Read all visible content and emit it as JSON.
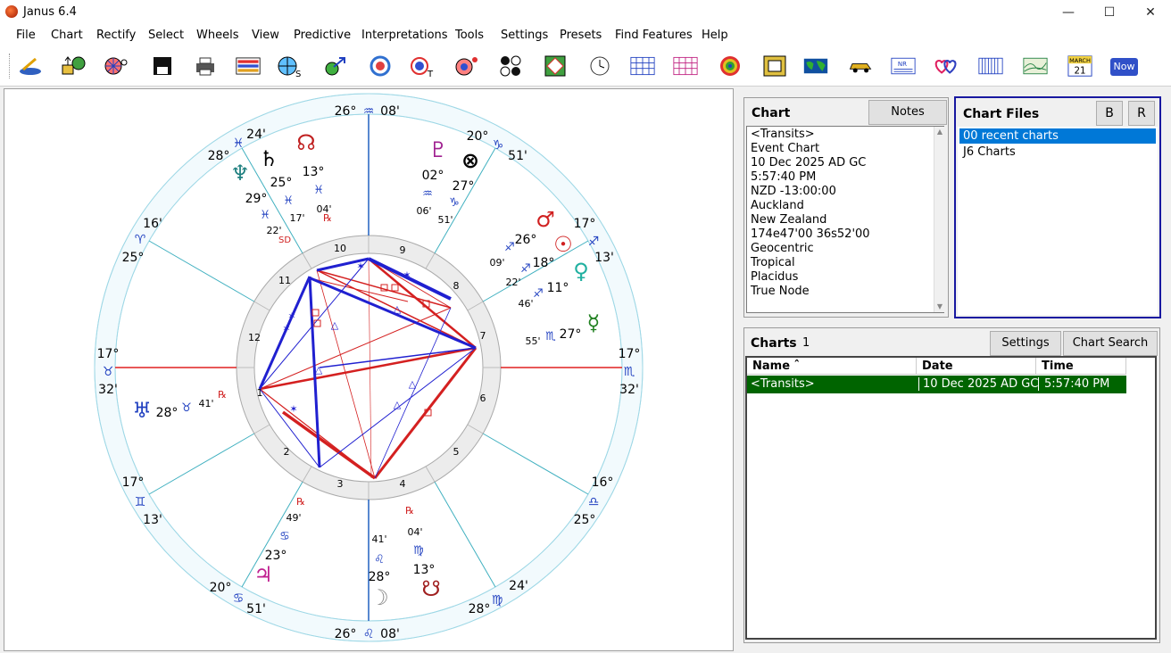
{
  "app": {
    "title": "Janus 6.4"
  },
  "menu": [
    "File",
    "Chart",
    "Rectify",
    "Select",
    "Wheels",
    "View",
    "Predictive",
    "Interpretations",
    "Tools",
    "Settings",
    "Presets",
    "Find Features",
    "Help"
  ],
  "toolbar_icons": [
    "draw-chart-icon",
    "open-chart-icon",
    "wheel-search-icon",
    "save-disk-icon",
    "print-icon",
    "grid-report-icon",
    "wheel-s-icon",
    "transit-arrow-icon",
    "wheel-ring-icon",
    "wheel-t-icon",
    "wheel-dot-icon",
    "four-circles-icon",
    "square-chart-icon",
    "clock-icon",
    "table-grid-icon",
    "aspect-grid-icon",
    "target-icon",
    "square-grid-icon",
    "world-map-icon",
    "car-icon",
    "nr-report-icon",
    "hearts-icon",
    "bar-report-icon",
    "map-chart-icon",
    "calendar-icon",
    "now-button-icon"
  ],
  "calendar": {
    "month": "MARCH",
    "day": "21"
  },
  "now_label": "Now",
  "wheel": {
    "outer_labels": [
      {
        "text": "26°",
        "sign": "♒",
        "min": "08'"
      },
      {
        "text": "20°",
        "sign": "♑",
        "min": "51'"
      },
      {
        "text": "17°",
        "sign": "♐",
        "min": "13'"
      },
      {
        "text": "17°",
        "sign": "♏",
        "min": "32'"
      },
      {
        "text": "16°",
        "sign": "♎",
        "min": "25°"
      },
      {
        "text": "24'",
        "sign": "♍",
        "min": "28°"
      },
      {
        "text": "26°",
        "sign": "♌",
        "min": "08'"
      },
      {
        "text": "20°",
        "sign": "♋",
        "min": "51'"
      },
      {
        "text": "17°",
        "sign": "♊",
        "min": "13'"
      },
      {
        "text": "17°",
        "sign": "♉",
        "min": "32'"
      },
      {
        "text": "16'",
        "sign": "♈",
        "min": "25°"
      },
      {
        "text": "28°",
        "sign": "♓",
        "min": "24'"
      }
    ],
    "house_numbers": [
      "1",
      "2",
      "3",
      "4",
      "5",
      "6",
      "7",
      "8",
      "9",
      "10",
      "11",
      "12"
    ],
    "planets": [
      {
        "glyph": "♇",
        "deg": "02°",
        "sign": "♒",
        "min": "06'"
      },
      {
        "glyph": "⊗",
        "deg": "27°",
        "sign": "♑",
        "min": "51'"
      },
      {
        "glyph": "♂",
        "deg": "26°",
        "sign": "♐",
        "min": "09'"
      },
      {
        "glyph": "☉",
        "deg": "18°",
        "sign": "♐",
        "min": "22'"
      },
      {
        "glyph": "♀",
        "deg": "11°",
        "sign": "♐",
        "min": "46'"
      },
      {
        "glyph": "☿",
        "deg": "27°",
        "sign": "♏",
        "min": "55'"
      },
      {
        "glyph": "☊",
        "deg": "13°",
        "sign": "♓",
        "min": "04'"
      },
      {
        "glyph": "♄",
        "deg": "25°",
        "sign": "♓",
        "min": "17'"
      },
      {
        "glyph": "♆",
        "deg": "29°",
        "sign": "♓",
        "min": "22'"
      },
      {
        "glyph": "♅",
        "deg": "28°",
        "sign": "♉",
        "min": "41'"
      },
      {
        "glyph": "♃",
        "deg": "23°",
        "sign": "♋",
        "min": "49'"
      },
      {
        "glyph": "☽",
        "deg": "28°",
        "sign": "♌",
        "min": "41'"
      },
      {
        "glyph": "☋",
        "deg": "13°",
        "sign": "♍",
        "min": "04'"
      }
    ],
    "retro": "℞",
    "sd": "SD"
  },
  "chart_panel": {
    "title": "Chart",
    "notes_button": "Notes",
    "lines": [
      "<Transits>",
      "Event Chart",
      "10 Dec 2025 AD GC",
      "5:57:40 PM",
      "NZD -13:00:00",
      "Auckland",
      "New Zealand",
      "174e47'00 36s52'00",
      "Geocentric",
      "Tropical",
      "Placidus",
      "True Node"
    ]
  },
  "chart_files": {
    "title": "Chart Files",
    "b_button": "B",
    "r_button": "R",
    "items": [
      "00 recent charts",
      "J6 Charts"
    ]
  },
  "charts_list": {
    "title": "Charts",
    "count": "1",
    "settings_button": "Settings",
    "search_button": "Chart Search",
    "columns": [
      "Name ˆ",
      "Date",
      "Time"
    ],
    "rows": [
      {
        "name": "<Transits>",
        "date": "10 Dec 2025 AD GC",
        "time": "5:57:40 PM"
      }
    ]
  },
  "colors": {
    "selected_blue": "#0078d7",
    "selected_green": "#006400",
    "panel_border": "#1818a0",
    "aspect_red": "#d42020",
    "aspect_blue": "#2020d0"
  }
}
